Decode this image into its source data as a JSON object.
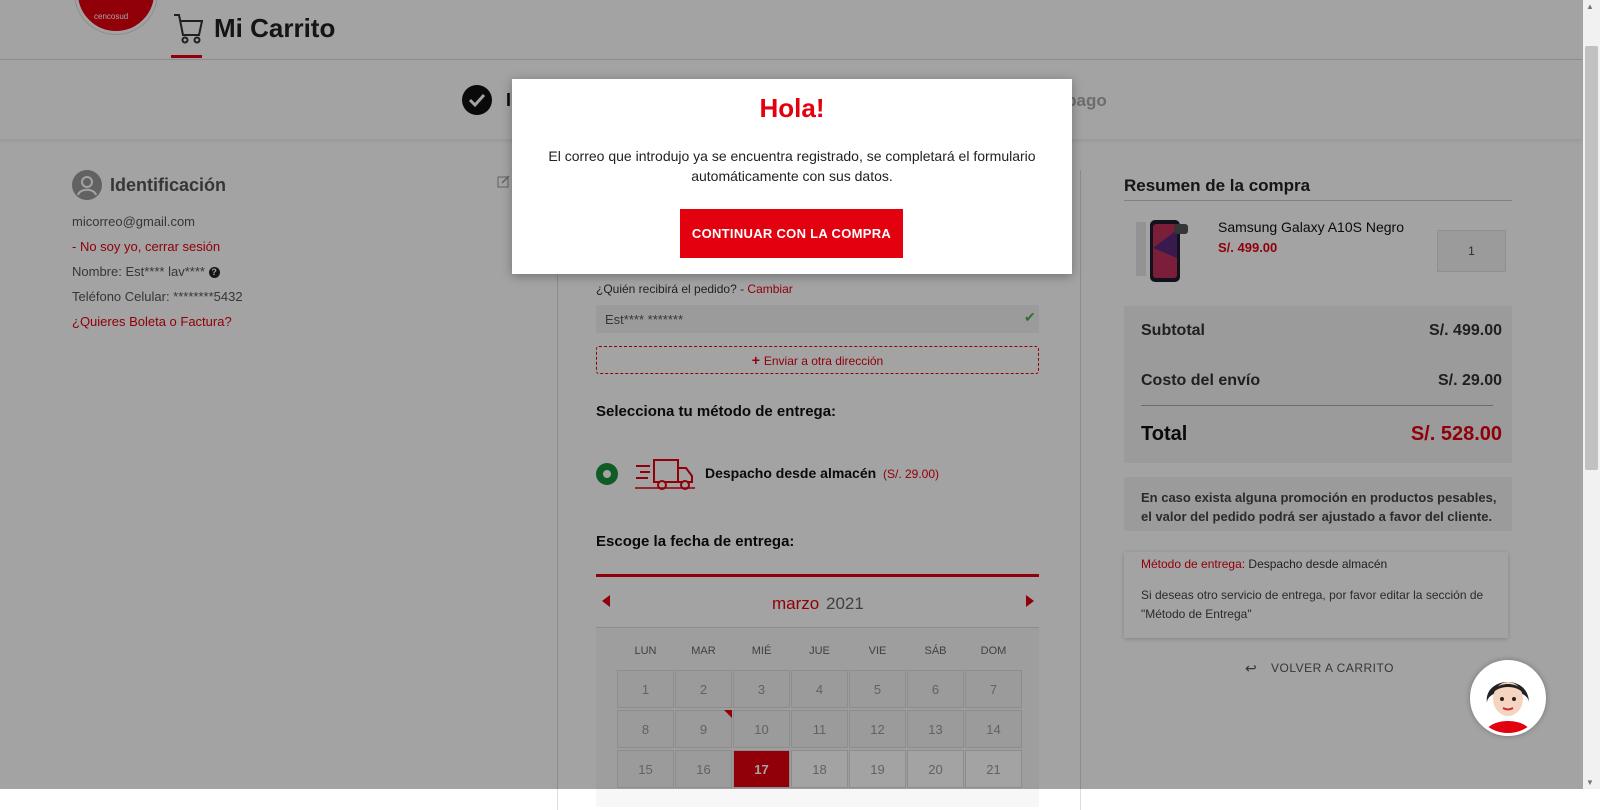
{
  "header": {
    "brand": "cencosud",
    "title": "Mi Carrito"
  },
  "steps": {
    "step1_initial": "I",
    "step3_partial": "e pago"
  },
  "identification": {
    "title": "Identificación",
    "email": "micorreo@gmail.com",
    "logout": "- No soy yo, cerrar sesión",
    "name": "Nombre: Est**** lav****",
    "phone": "Teléfono Celular:  ********5432",
    "invoice_link": "¿Quieres Boleta o Factura?"
  },
  "delivery": {
    "receiver_label": "¿Quién recibirá el pedido? -",
    "receiver_change": "Cambiar",
    "receiver_value": "Est****  *******",
    "other_address": "Enviar a otra dirección",
    "method_title": "Selecciona tu método de entrega:",
    "method_name": "Despacho desde almacén",
    "method_price": "(S/. 29.00)",
    "date_title": "Escoge la fecha de entrega:"
  },
  "calendar": {
    "month": "marzo",
    "year": "2021",
    "weekdays": [
      "LUN",
      "MAR",
      "MIÉ",
      "JUE",
      "VIE",
      "SÁB",
      "DOM"
    ],
    "rows": [
      [
        "1",
        "2",
        "3",
        "4",
        "5",
        "6",
        "7"
      ],
      [
        "8",
        "9",
        "10",
        "11",
        "12",
        "13",
        "14"
      ],
      [
        "15",
        "16",
        "17",
        "18",
        "19",
        "20",
        "21"
      ]
    ],
    "selected": "17"
  },
  "summary": {
    "title": "Resumen de la compra",
    "product_name": "Samsung Galaxy A10S Negro",
    "product_price": "S/. 499.00",
    "quantity": "1",
    "subtotal_label": "Subtotal",
    "subtotal_value": "S/. 499.00",
    "shipping_label": "Costo del envío",
    "shipping_value": "S/. 29.00",
    "total_label": "Total",
    "total_value": "S/. 528.00",
    "note": "En caso exista alguna promoción en productos pesables, el valor del pedido podrá ser ajustado a favor del cliente.",
    "method_label": "Método de entrega:",
    "method_value": "Despacho desde almacén",
    "method_note": "Si deseas otro servicio de entrega, por favor editar la sección de \"Método de Entrega\"",
    "back_link": "VOLVER A CARRITO"
  },
  "modal": {
    "title": "Hola!",
    "body": "El correo que introdujo ya se encuentra registrado, se completará el formulario automáticamente con sus datos.",
    "button": "CONTINUAR CON LA COMPRA"
  },
  "colors": {
    "accent": "#e3000f",
    "radio": "#1a8f3c",
    "overlay": "rgba(0,0,0,0.36)"
  }
}
